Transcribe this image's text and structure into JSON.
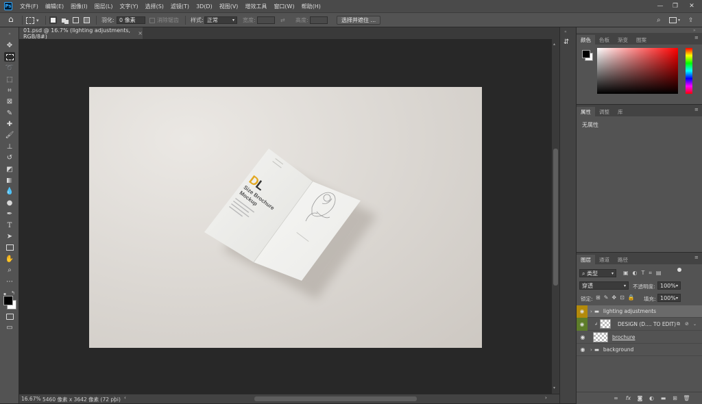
{
  "menu": [
    "文件(F)",
    "编辑(E)",
    "图像(I)",
    "图层(L)",
    "文字(Y)",
    "选择(S)",
    "滤镜(T)",
    "3D(D)",
    "视图(V)",
    "增效工具",
    "窗口(W)",
    "帮助(H)"
  ],
  "options": {
    "feather_label": "羽化:",
    "feather_value": "0 像素",
    "antialias": "消除锯齿",
    "style_label": "样式:",
    "style_value": "正常",
    "width_label": "宽度:",
    "height_label": "高度:",
    "select_mask": "选择并遮住 ..."
  },
  "document": {
    "tab_title": "01.psd @ 16.7% (lighting adjustments, RGB/8#)",
    "close_glyph": "×"
  },
  "status": {
    "zoom": "16.67%",
    "info": "5460 像素 x 3642 像素 (72 ppi)"
  },
  "brochure": {
    "logo_d": "D",
    "logo_l": "L",
    "line1": "Size Brochure",
    "line2": "Mockup"
  },
  "color_panel": {
    "tabs": [
      "颜色",
      "色板",
      "渐变",
      "图案"
    ]
  },
  "properties_panel": {
    "tabs": [
      "属性",
      "调整",
      "库"
    ],
    "empty_text": "无属性"
  },
  "layers_panel": {
    "tabs": [
      "图层",
      "通道",
      "路径"
    ],
    "filter_label": "类型",
    "blend_mode": "穿透",
    "opacity_label": "不透明度:",
    "opacity_value": "100%",
    "lock_label": "锁定:",
    "fill_label": "填充:",
    "fill_value": "100%",
    "layers": [
      {
        "name": "lighting adjustments",
        "type": "group",
        "color": "#b38a0b"
      },
      {
        "name": "DESIGN (D.... TO EDIT)",
        "type": "smart",
        "color": "#5d7d2a"
      },
      {
        "name": "brochure",
        "type": "pixel",
        "color": ""
      },
      {
        "name": "background",
        "type": "group",
        "color": ""
      }
    ]
  },
  "colors": {
    "fg": "#000000",
    "bg": "#ffffff",
    "accent": "#e2a823"
  }
}
